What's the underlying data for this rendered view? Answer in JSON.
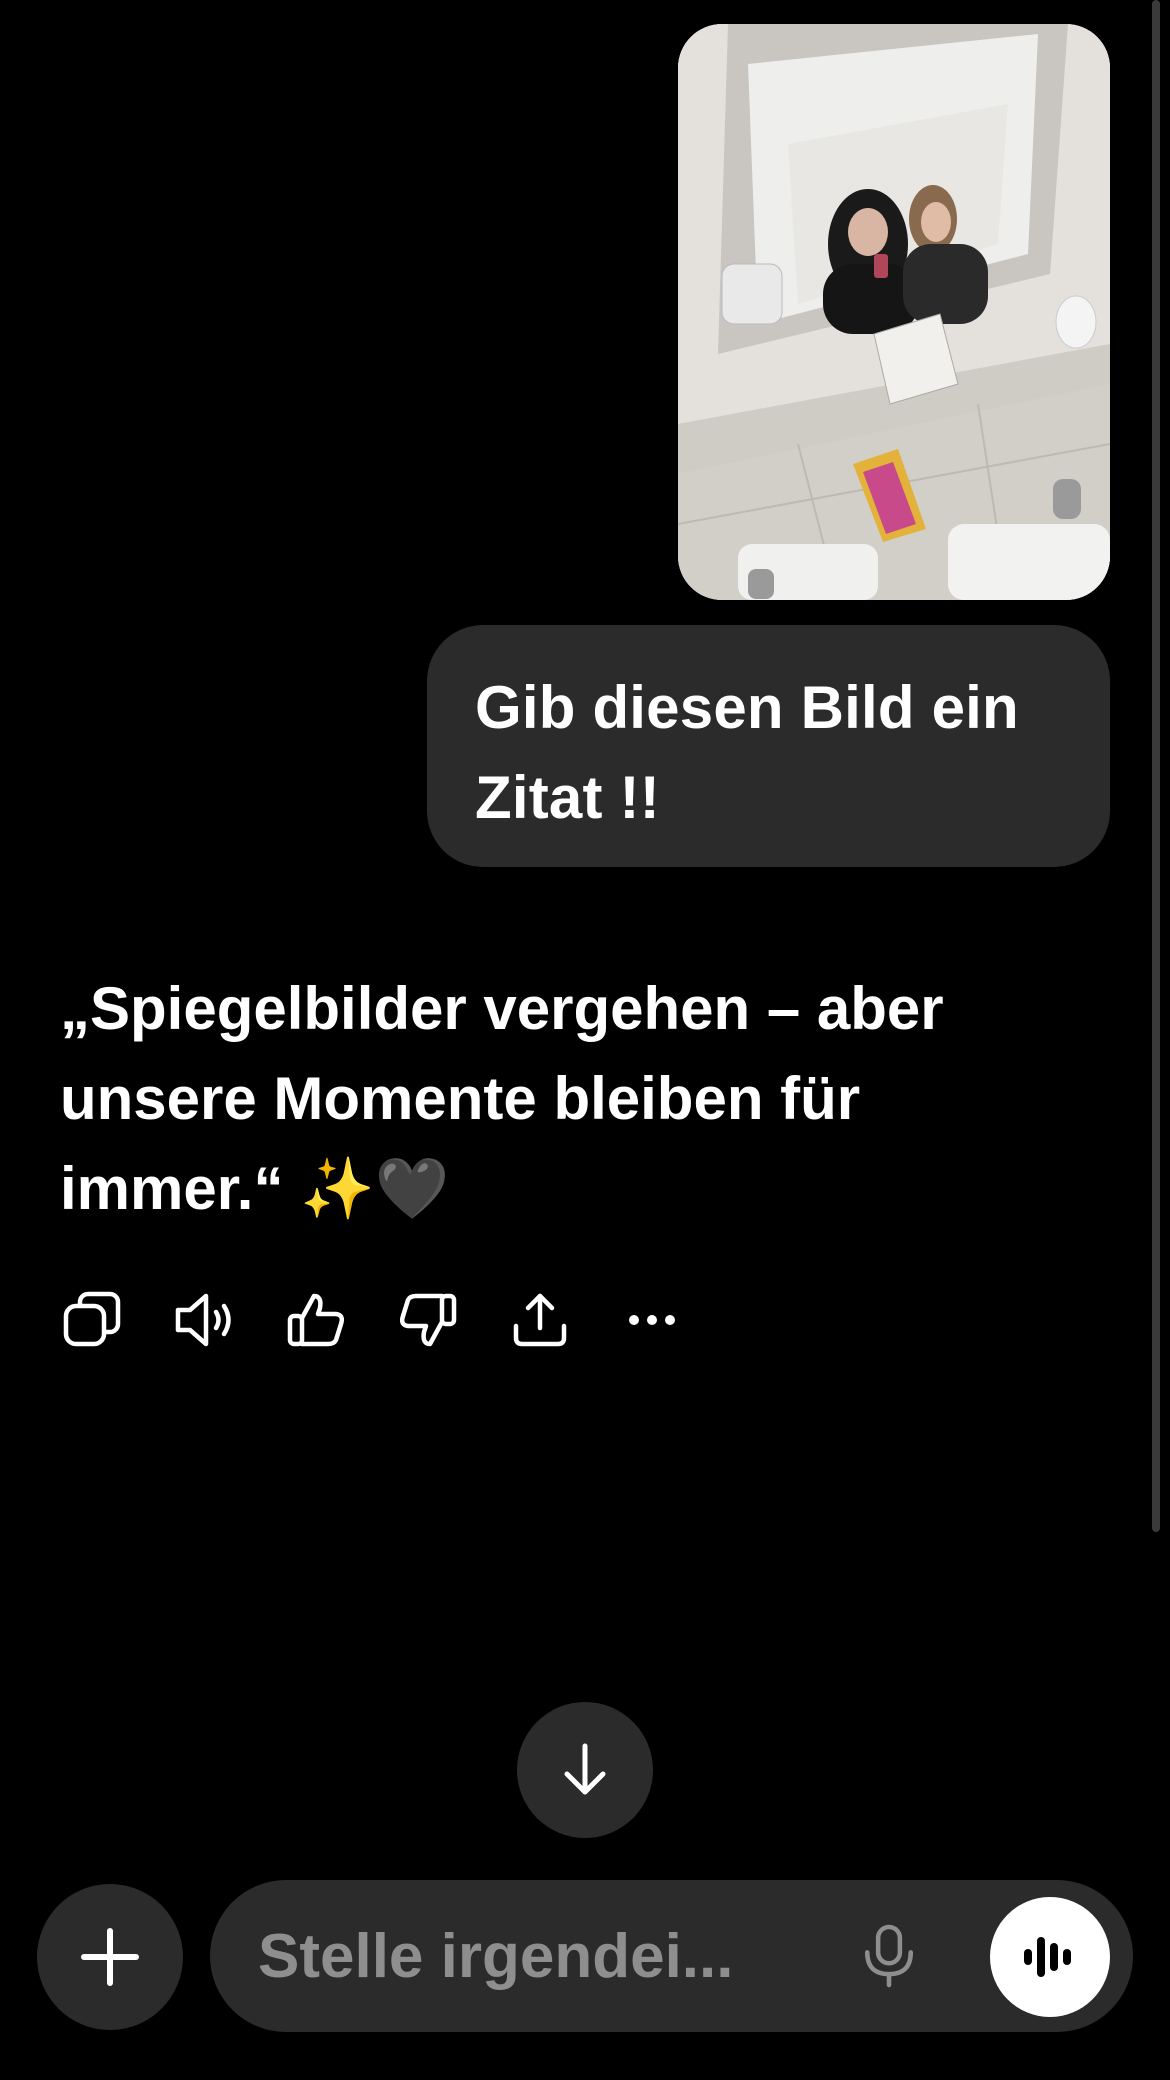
{
  "conversation": {
    "user_message": "Gib diesen Bild ein Zitat !!",
    "assistant_message": "„Spiegelbilder vergehen – aber unsere Momente bleiben für immer.“ ✨🖤"
  },
  "composer": {
    "placeholder": "Stelle irgendei..."
  },
  "icons": {
    "copy": "copy-icon",
    "read_aloud": "speaker-icon",
    "like": "thumbs-up-icon",
    "dislike": "thumbs-down-icon",
    "share": "share-icon",
    "more": "more-icon",
    "scroll_down": "arrow-down-icon",
    "add": "plus-icon",
    "dictate": "microphone-icon",
    "voice": "voice-mode-icon"
  },
  "colors": {
    "background": "#000000",
    "bubble": "#2b2b2b",
    "text": "#ffffff",
    "placeholder": "#8e8e8e"
  }
}
